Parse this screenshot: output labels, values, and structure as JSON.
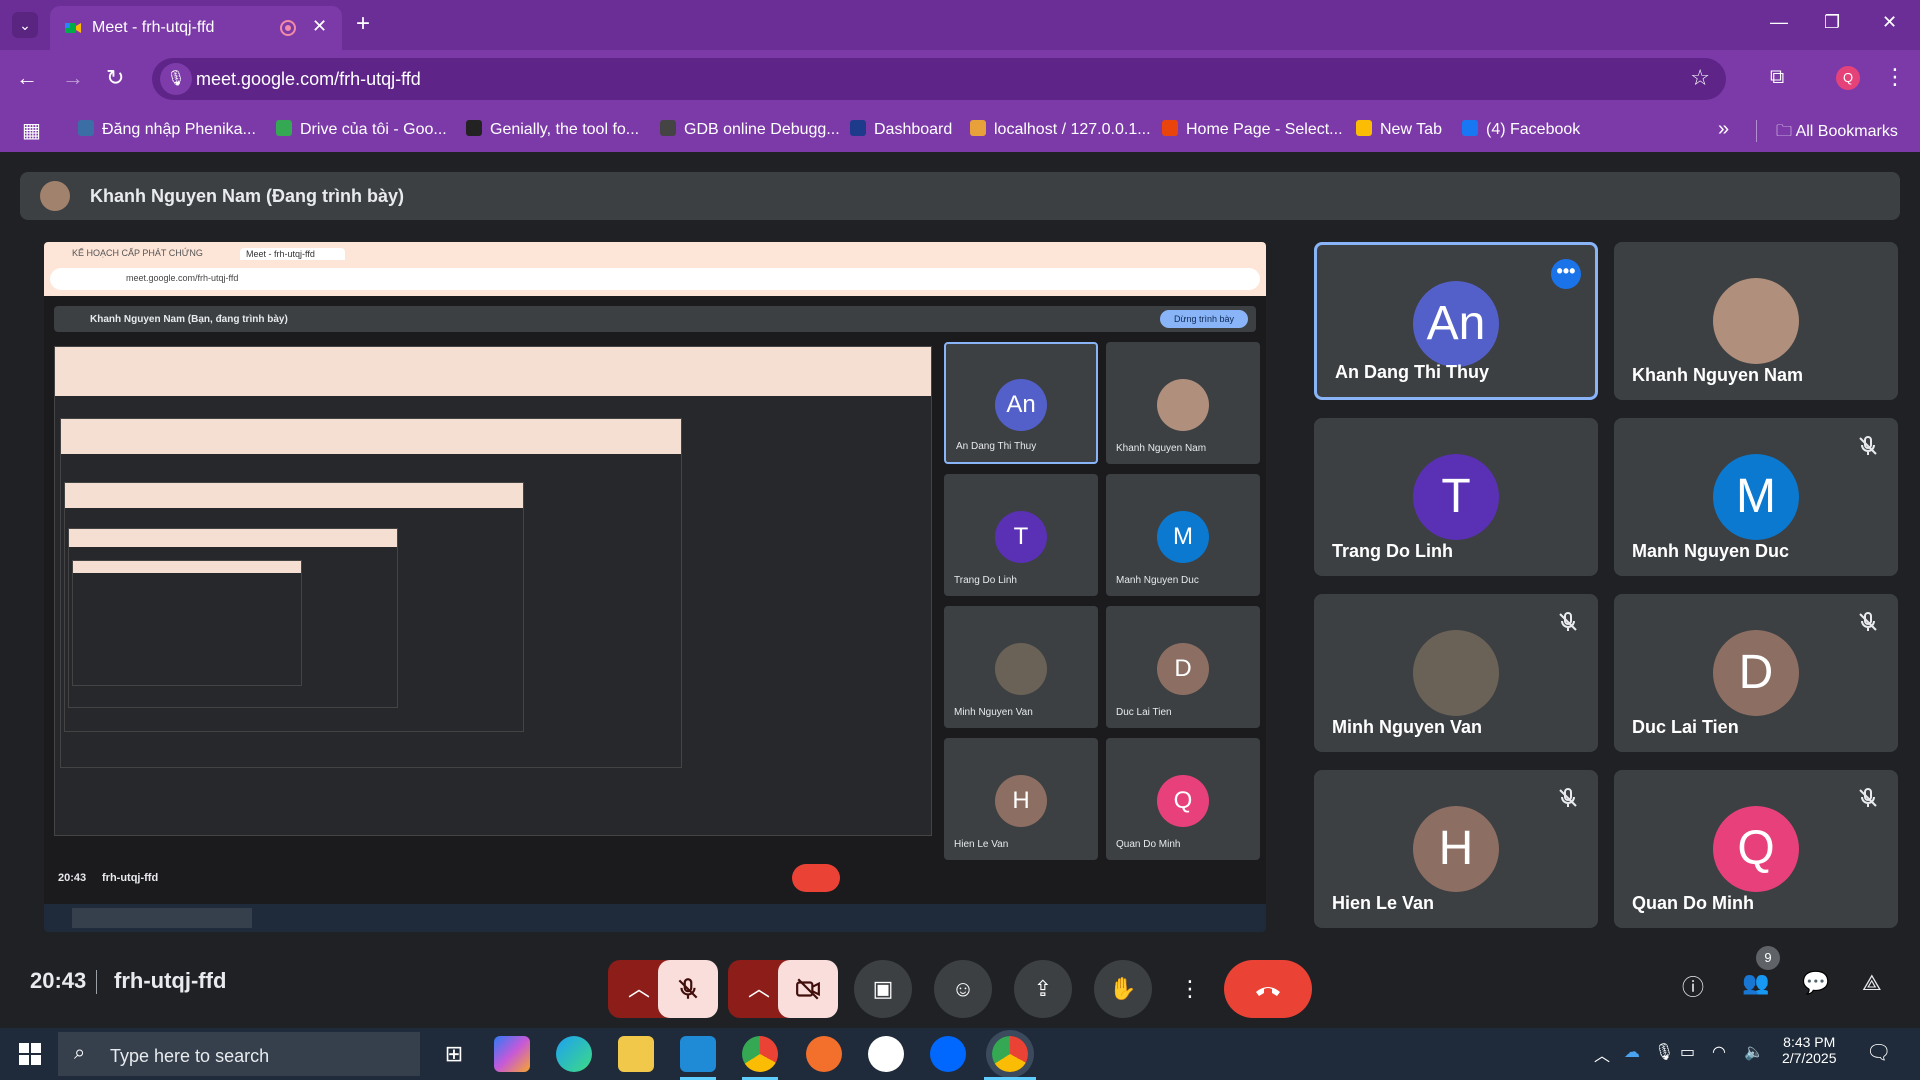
{
  "browser": {
    "tab_title": "Meet - frh-utqj-ffd",
    "url": "meet.google.com/frh-utqj-ffd",
    "profile_initial": "Q"
  },
  "bookmarks": [
    {
      "label": "Đăng nhập Phenika...",
      "color": "#3a6ea5"
    },
    {
      "label": "Drive của tôi - Goo...",
      "color": "#34a853"
    },
    {
      "label": "Genially, the tool fo...",
      "color": "#222222"
    },
    {
      "label": "GDB online Debugg...",
      "color": "#444444"
    },
    {
      "label": "Dashboard",
      "color": "#1e3a8a"
    },
    {
      "label": "localhost / 127.0.0.1...",
      "color": "#e8a13a"
    },
    {
      "label": "Home Page - Select...",
      "color": "#e8440b"
    },
    {
      "label": "New Tab",
      "color": "#fbbc04"
    },
    {
      "label": "(4) Facebook",
      "color": "#1877f2"
    }
  ],
  "bookmarks_all": "All Bookmarks",
  "meet": {
    "presenter_label": "Khanh Nguyen Nam (Đang trình bày)",
    "time": "20:43",
    "meeting_code": "frh-utqj-ffd",
    "participant_count": "9"
  },
  "participants": [
    {
      "name": "An Dang Thi Thuy",
      "initial": "An",
      "color": "#5360c9",
      "muted": false,
      "active": true,
      "photo": false
    },
    {
      "name": "Khanh Nguyen Nam",
      "initial": "",
      "color": "#b08f7c",
      "muted": false,
      "active": false,
      "photo": true
    },
    {
      "name": "Trang Do Linh",
      "initial": "T",
      "color": "#5a30b5",
      "muted": false,
      "active": false,
      "photo": false
    },
    {
      "name": "Manh Nguyen Duc",
      "initial": "M",
      "color": "#0b79d0",
      "muted": true,
      "active": false,
      "photo": false
    },
    {
      "name": "Minh Nguyen Van",
      "initial": "",
      "color": "#6b6257",
      "muted": true,
      "active": false,
      "photo": true
    },
    {
      "name": "Duc Lai Tien",
      "initial": "D",
      "color": "#8d6e63",
      "muted": true,
      "active": false,
      "photo": false
    },
    {
      "name": "Hien Le Van",
      "initial": "H",
      "color": "#8d6e63",
      "muted": true,
      "active": false,
      "photo": false
    },
    {
      "name": "Quan Do Minh",
      "initial": "Q",
      "color": "#e8407a",
      "muted": true,
      "active": false,
      "photo": false
    }
  ],
  "shared_screen": {
    "presenting_label": "Khanh Nguyen Nam (Bạn, đang trình bày)",
    "stop_button": "Dừng trình bày",
    "time": "20:43",
    "code": "frh-utqj-ffd",
    "tab1": "KẾ HOẠCH CẤP PHÁT CHỨNG",
    "tab2": "Meet - frh-utqj-ffd",
    "url": "meet.google.com/frh-utqj-ffd"
  },
  "taskbar": {
    "search_placeholder": "Type here to search",
    "time": "8:43 PM",
    "date": "2/7/2025"
  }
}
